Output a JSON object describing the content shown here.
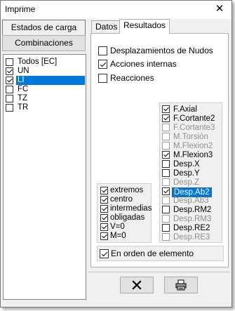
{
  "window": {
    "title": "Imprime",
    "close_glyph": "✕"
  },
  "left": {
    "buttons": [
      {
        "label": "Estados de carga",
        "active": true
      },
      {
        "label": "Combinaciones",
        "active": false
      }
    ],
    "items": [
      {
        "label": "Todos [EC]",
        "checked": false,
        "selected": false
      },
      {
        "label": "UN",
        "checked": true,
        "selected": false
      },
      {
        "label": "LI",
        "checked": true,
        "selected": true
      },
      {
        "label": "FC",
        "checked": false,
        "selected": false
      },
      {
        "label": "TZ",
        "checked": false,
        "selected": false
      },
      {
        "label": "TR",
        "checked": false,
        "selected": false
      }
    ]
  },
  "tabs": [
    {
      "label": "Datos",
      "active": false
    },
    {
      "label": "Resultados",
      "active": true
    }
  ],
  "results": {
    "options": [
      {
        "label": "Desplazamientos de Nudos",
        "checked": false
      },
      {
        "label": "Acciones internas",
        "checked": true
      },
      {
        "label": "Reacciones",
        "checked": false
      }
    ],
    "properties": [
      {
        "label": "F.Axial",
        "checked": true,
        "disabled": false,
        "selected": false
      },
      {
        "label": "F.Cortante2",
        "checked": true,
        "disabled": false,
        "selected": false
      },
      {
        "label": "F.Cortante3",
        "checked": false,
        "disabled": true,
        "selected": false
      },
      {
        "label": "M.Torsión",
        "checked": false,
        "disabled": true,
        "selected": false
      },
      {
        "label": "M.Flexion2",
        "checked": false,
        "disabled": true,
        "selected": false
      },
      {
        "label": "M.Flexion3",
        "checked": true,
        "disabled": false,
        "selected": false
      },
      {
        "label": "Desp.X",
        "checked": false,
        "disabled": false,
        "selected": false
      },
      {
        "label": "Desp.Y",
        "checked": false,
        "disabled": false,
        "selected": false
      },
      {
        "label": "Desp.Z",
        "checked": false,
        "disabled": true,
        "selected": false
      },
      {
        "label": "Desp.Ab2",
        "checked": true,
        "disabled": false,
        "selected": true
      },
      {
        "label": "Desp.Ab3",
        "checked": false,
        "disabled": true,
        "selected": false
      },
      {
        "label": "Desp.RM2",
        "checked": false,
        "disabled": false,
        "selected": false
      },
      {
        "label": "Desp.RM3",
        "checked": false,
        "disabled": true,
        "selected": false
      },
      {
        "label": "Desp.RE2",
        "checked": false,
        "disabled": false,
        "selected": false
      },
      {
        "label": "Desp.RE3",
        "checked": false,
        "disabled": true,
        "selected": false
      }
    ],
    "positions": [
      {
        "label": "extremos",
        "checked": true
      },
      {
        "label": "centro",
        "checked": true
      },
      {
        "label": "intermedias",
        "checked": true
      },
      {
        "label": "obligadas",
        "checked": true
      },
      {
        "label": "V=0",
        "checked": true
      },
      {
        "label": "M=0",
        "checked": true
      }
    ],
    "orden": {
      "label": "En orden de elemento",
      "checked": true
    }
  },
  "footer": {
    "cancel_icon": "close-x-icon",
    "print_icon": "printer-icon"
  },
  "colors": {
    "selection": "#0078d7",
    "disabled_text": "#8f8f8f"
  }
}
